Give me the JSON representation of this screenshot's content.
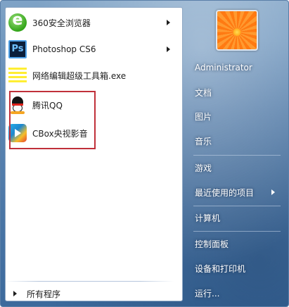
{
  "left": {
    "pinned": [
      {
        "label": "360安全浏览器",
        "icon": "360-browser-icon",
        "has_submenu": true
      },
      {
        "label": "Photoshop CS6",
        "icon": "photoshop-icon",
        "has_submenu": true
      },
      {
        "label": "网络编辑超级工具箱.exe",
        "icon": "toolbox-icon",
        "has_submenu": false
      }
    ],
    "recent": [
      {
        "label": "腾讯QQ",
        "icon": "qq-penguin-icon"
      },
      {
        "label": "CBox央视影音",
        "icon": "cbox-icon"
      }
    ],
    "all_programs": "所有程序"
  },
  "right": {
    "user": "Administrator",
    "items": [
      "文档",
      "图片",
      "音乐",
      "游戏",
      "最近使用的项目",
      "计算机",
      "控制面板",
      "设备和打印机",
      "运行..."
    ]
  },
  "colors": {
    "highlight_border": "#c0303a",
    "pane_blue": "#5f88b4",
    "submenu_arrow": "#1e1e1e"
  }
}
